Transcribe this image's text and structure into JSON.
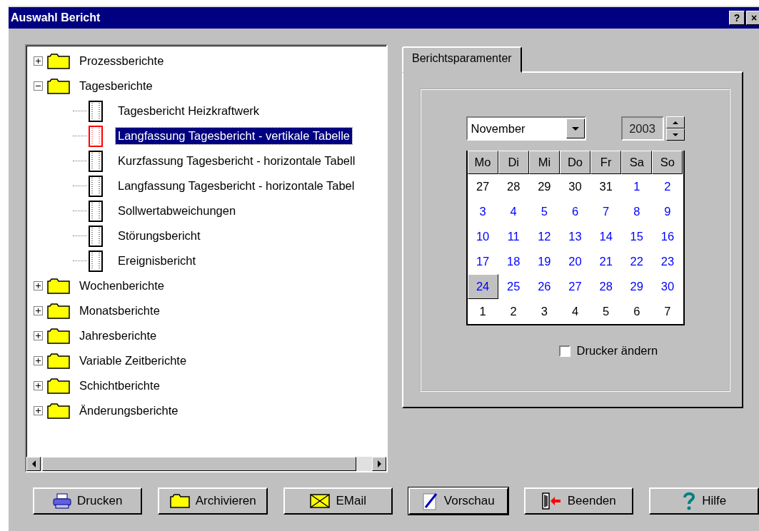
{
  "window": {
    "title": "Auswahl Bericht",
    "title_buttons": [
      "?",
      "×"
    ]
  },
  "tree": [
    {
      "label": "Prozessberichte",
      "kind": "folder",
      "expanded": false,
      "selected": false
    },
    {
      "label": "Tagesberichte",
      "kind": "folder",
      "expanded": true,
      "selected": false,
      "children": [
        {
          "label": "Tagesbericht Heizkraftwerk",
          "kind": "report",
          "selected": false
        },
        {
          "label": "Langfassung Tagesbericht - vertikale Tabelle",
          "kind": "report",
          "selected": true
        },
        {
          "label": "Kurzfassung Tagesbericht - horizontale Tabell",
          "kind": "report",
          "selected": false
        },
        {
          "label": "Langfassung Tagesbericht - horizontale Tabel",
          "kind": "report",
          "selected": false
        },
        {
          "label": "Sollwertabweichungen",
          "kind": "report",
          "selected": false
        },
        {
          "label": "Störungsbericht",
          "kind": "report",
          "selected": false
        },
        {
          "label": "Ereignisbericht",
          "kind": "report",
          "selected": false
        }
      ]
    },
    {
      "label": "Wochenberichte",
      "kind": "folder",
      "expanded": false,
      "selected": false
    },
    {
      "label": "Monatsberichte",
      "kind": "folder",
      "expanded": false,
      "selected": false
    },
    {
      "label": "Jahresberichte",
      "kind": "folder",
      "expanded": false,
      "selected": false
    },
    {
      "label": "Variable Zeitberichte",
      "kind": "folder",
      "expanded": false,
      "selected": false
    },
    {
      "label": "Schichtberichte",
      "kind": "folder",
      "expanded": false,
      "selected": false
    },
    {
      "label": "Änderungsberichte",
      "kind": "folder",
      "expanded": false,
      "selected": false
    }
  ],
  "tabs": [
    {
      "label": "Berichtsparamenter",
      "selected": true
    }
  ],
  "calendar": {
    "month": "November",
    "year": "2003",
    "weekdays": [
      "Mo",
      "Di",
      "Mi",
      "Do",
      "Fr",
      "Sa",
      "So"
    ],
    "days": [
      {
        "day": "27",
        "in_month": false,
        "selected": false
      },
      {
        "day": "28",
        "in_month": false,
        "selected": false
      },
      {
        "day": "29",
        "in_month": false,
        "selected": false
      },
      {
        "day": "30",
        "in_month": false,
        "selected": false
      },
      {
        "day": "31",
        "in_month": false,
        "selected": false
      },
      {
        "day": "1",
        "in_month": true,
        "selected": false
      },
      {
        "day": "2",
        "in_month": true,
        "selected": false
      },
      {
        "day": "3",
        "in_month": true,
        "selected": false
      },
      {
        "day": "4",
        "in_month": true,
        "selected": false
      },
      {
        "day": "5",
        "in_month": true,
        "selected": false
      },
      {
        "day": "6",
        "in_month": true,
        "selected": false
      },
      {
        "day": "7",
        "in_month": true,
        "selected": false
      },
      {
        "day": "8",
        "in_month": true,
        "selected": false
      },
      {
        "day": "9",
        "in_month": true,
        "selected": false
      },
      {
        "day": "10",
        "in_month": true,
        "selected": false
      },
      {
        "day": "11",
        "in_month": true,
        "selected": false
      },
      {
        "day": "12",
        "in_month": true,
        "selected": false
      },
      {
        "day": "13",
        "in_month": true,
        "selected": false
      },
      {
        "day": "14",
        "in_month": true,
        "selected": false
      },
      {
        "day": "15",
        "in_month": true,
        "selected": false
      },
      {
        "day": "16",
        "in_month": true,
        "selected": false
      },
      {
        "day": "17",
        "in_month": true,
        "selected": false
      },
      {
        "day": "18",
        "in_month": true,
        "selected": false
      },
      {
        "day": "19",
        "in_month": true,
        "selected": false
      },
      {
        "day": "20",
        "in_month": true,
        "selected": false
      },
      {
        "day": "21",
        "in_month": true,
        "selected": false
      },
      {
        "day": "22",
        "in_month": true,
        "selected": false
      },
      {
        "day": "23",
        "in_month": true,
        "selected": false
      },
      {
        "day": "24",
        "in_month": true,
        "selected": true
      },
      {
        "day": "25",
        "in_month": true,
        "selected": false
      },
      {
        "day": "26",
        "in_month": true,
        "selected": false
      },
      {
        "day": "27",
        "in_month": true,
        "selected": false
      },
      {
        "day": "28",
        "in_month": true,
        "selected": false
      },
      {
        "day": "29",
        "in_month": true,
        "selected": false
      },
      {
        "day": "30",
        "in_month": true,
        "selected": false
      },
      {
        "day": "1",
        "in_month": false,
        "selected": false
      },
      {
        "day": "2",
        "in_month": false,
        "selected": false
      },
      {
        "day": "3",
        "in_month": false,
        "selected": false
      },
      {
        "day": "4",
        "in_month": false,
        "selected": false
      },
      {
        "day": "5",
        "in_month": false,
        "selected": false
      },
      {
        "day": "6",
        "in_month": false,
        "selected": false
      },
      {
        "day": "7",
        "in_month": false,
        "selected": false
      }
    ]
  },
  "change_printer": {
    "label": "Drucker ändern",
    "checked": false
  },
  "buttons": [
    {
      "label": "Drucken",
      "kind": "print",
      "default": false
    },
    {
      "label": "Archivieren",
      "kind": "archive",
      "default": false
    },
    {
      "label": "EMail",
      "kind": "email",
      "default": false
    },
    {
      "label": "Vorschau",
      "kind": "preview",
      "default": true
    },
    {
      "label": "Beenden",
      "kind": "exit",
      "default": false
    },
    {
      "label": "Hilfe",
      "kind": "help",
      "default": false
    }
  ]
}
